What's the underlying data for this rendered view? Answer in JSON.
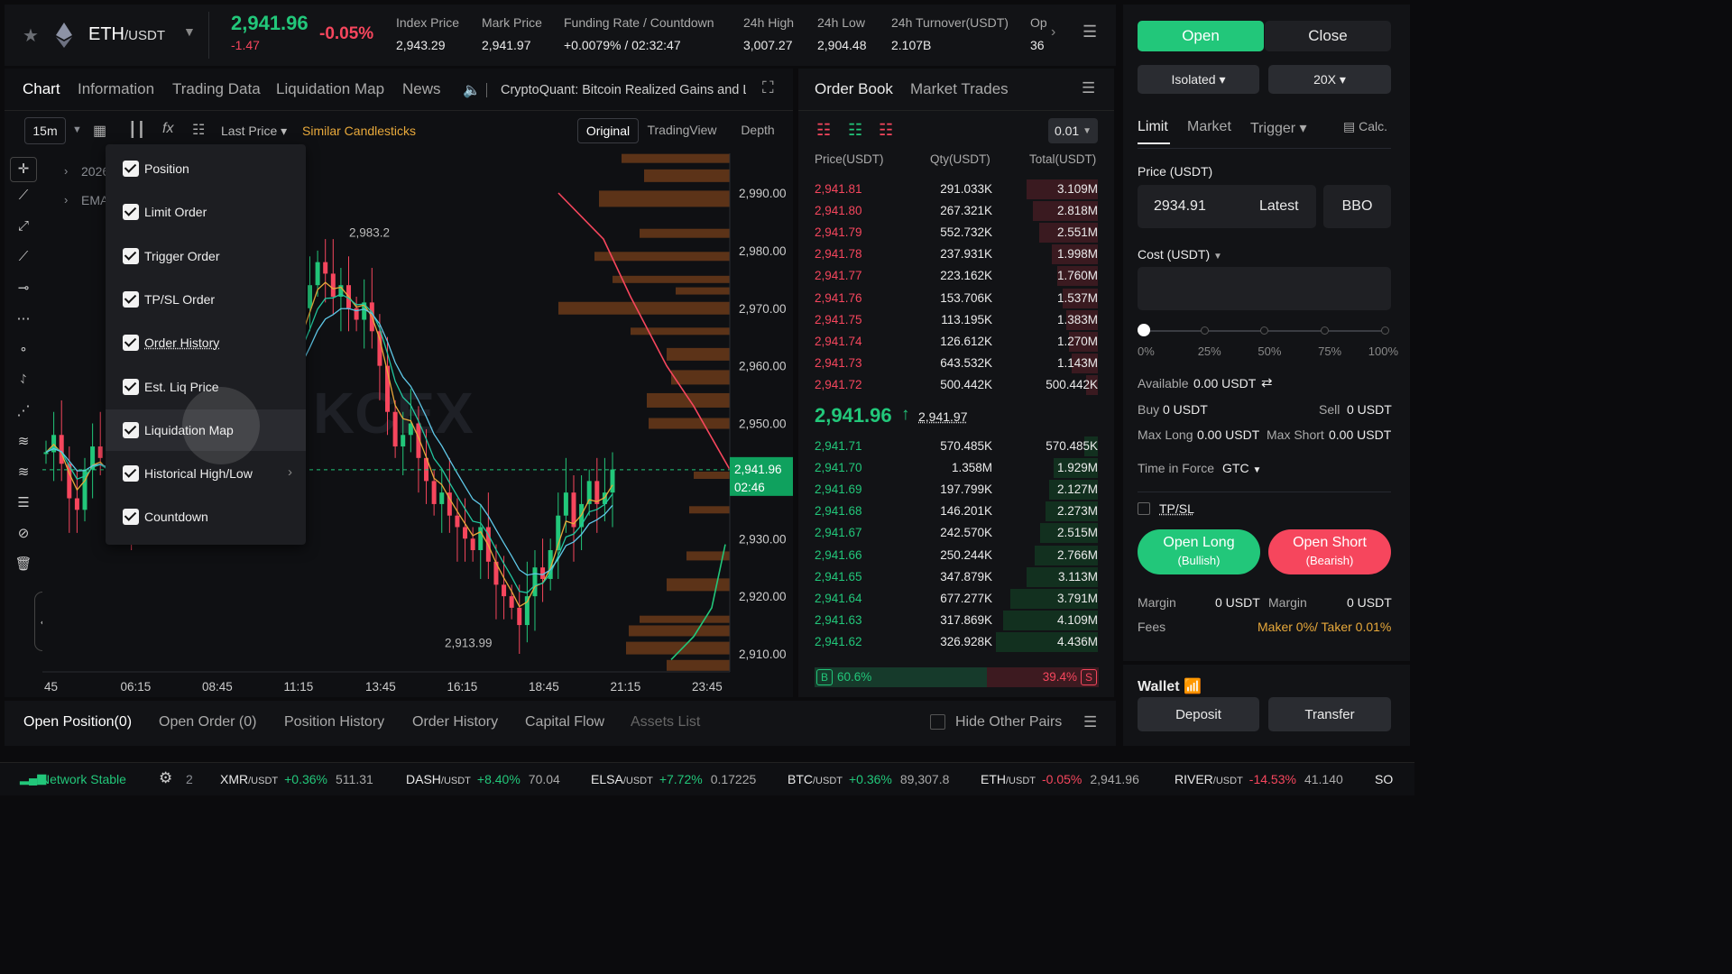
{
  "header": {
    "pair": "ETH",
    "quote": "/USDT",
    "last": "2,941.96",
    "change_abs": "-1.47",
    "change_pct": "-0.05%",
    "stats": [
      {
        "label": "Index Price",
        "value": "2,943.29"
      },
      {
        "label": "Mark Price",
        "value": "2,941.97"
      },
      {
        "label": "Funding Rate / Countdown",
        "value": "+0.0079% / 02:32:47"
      },
      {
        "label": "24h High",
        "value": "3,007.27"
      },
      {
        "label": "24h Low",
        "value": "2,904.48"
      },
      {
        "label": "24h Turnover(USDT)",
        "value": "2.107B"
      },
      {
        "label": "Op",
        "value": "36"
      }
    ]
  },
  "tabs": [
    "Chart",
    "Information",
    "Trading Data",
    "Liquidation Map",
    "News"
  ],
  "news_ticker": "CryptoQuant: Bitcoin Realized Gains and Lo",
  "toolbar": {
    "interval": "15m",
    "price_type": "Last Price",
    "similar": "Similar Candlesticks",
    "views": [
      "Original",
      "TradingView",
      "Depth"
    ]
  },
  "indicators": [
    "2026",
    "EMA"
  ],
  "menu": [
    "Position",
    "Limit Order",
    "Trigger Order",
    "TP/SL Order",
    "Order History",
    "Est. Liq Price",
    "Liquidation Map",
    "Historical High/Low",
    "Countdown"
  ],
  "chart": {
    "y_ticks": [
      "2,990.00",
      "2,980.00",
      "2,970.00",
      "2,960.00",
      "2,950.00",
      "2,930.00",
      "2,920.00",
      "2,910.00"
    ],
    "x_ticks": [
      "45",
      "06:15",
      "08:45",
      "11:15",
      "13:45",
      "16:15",
      "18:45",
      "21:15",
      "23:45"
    ],
    "high_label": "2,983.2",
    "low_label": "2,913.99",
    "price_tag": "2,941.96",
    "countdown_tag": "02:46",
    "watermark": "KCEX"
  },
  "orderbook": {
    "tabs": [
      "Order Book",
      "Market Trades"
    ],
    "precision": "0.01",
    "headers": [
      "Price(USDT)",
      "Qty(USDT)",
      "Total(USDT)"
    ],
    "asks": [
      [
        "2,941.81",
        "291.033K",
        "3.109M"
      ],
      [
        "2,941.80",
        "267.321K",
        "2.818M"
      ],
      [
        "2,941.79",
        "552.732K",
        "2.551M"
      ],
      [
        "2,941.78",
        "237.931K",
        "1.998M"
      ],
      [
        "2,941.77",
        "223.162K",
        "1.760M"
      ],
      [
        "2,941.76",
        "153.706K",
        "1.537M"
      ],
      [
        "2,941.75",
        "113.195K",
        "1.383M"
      ],
      [
        "2,941.74",
        "126.612K",
        "1.270M"
      ],
      [
        "2,941.73",
        "643.532K",
        "1.143M"
      ],
      [
        "2,941.72",
        "500.442K",
        "500.442K"
      ]
    ],
    "mid": "2,941.96",
    "mid_arrow": "↑",
    "mark": "2,941.97",
    "bids": [
      [
        "2,941.71",
        "570.485K",
        "570.485K"
      ],
      [
        "2,941.70",
        "1.358M",
        "1.929M"
      ],
      [
        "2,941.69",
        "197.799K",
        "2.127M"
      ],
      [
        "2,941.68",
        "146.201K",
        "2.273M"
      ],
      [
        "2,941.67",
        "242.570K",
        "2.515M"
      ],
      [
        "2,941.66",
        "250.244K",
        "2.766M"
      ],
      [
        "2,941.65",
        "347.879K",
        "3.113M"
      ],
      [
        "2,941.64",
        "677.277K",
        "3.791M"
      ],
      [
        "2,941.63",
        "317.869K",
        "4.109M"
      ],
      [
        "2,941.62",
        "326.928K",
        "4.436M"
      ]
    ],
    "buy_pct": "60.6%",
    "sell_pct": "39.4%",
    "b": "B",
    "s": "S"
  },
  "trade": {
    "open": "Open",
    "close": "Close",
    "margin_mode": "Isolated",
    "leverage": "20X",
    "types": [
      "Limit",
      "Market",
      "Trigger"
    ],
    "calc": "Calc.",
    "price_label": "Price (USDT)",
    "price_value": "2934.91",
    "latest": "Latest",
    "bbo": "BBO",
    "cost_label": "Cost (USDT)",
    "slider": [
      "0%",
      "25%",
      "50%",
      "75%",
      "100%"
    ],
    "available_label": "Available",
    "available": "0.00 USDT",
    "buy_label": "Buy",
    "buy": "0 USDT",
    "sell_label": "Sell",
    "sell": "0 USDT",
    "max_long_label": "Max Long",
    "max_long": "0.00 USDT",
    "max_short_label": "Max Short",
    "max_short": "0.00 USDT",
    "tif_label": "Time in Force",
    "tif": "GTC",
    "tpsl": "TP/SL",
    "long": "Open Long",
    "long_sub": "(Bullish)",
    "short": "Open Short",
    "short_sub": "(Bearish)",
    "margin_label": "Margin",
    "margin": "0 USDT",
    "margin2": "0 USDT",
    "fees_label": "Fees",
    "fees": "Maker 0%/ Taker 0.01%"
  },
  "wallet": {
    "title": "Wallet",
    "deposit": "Deposit",
    "transfer": "Transfer"
  },
  "bottom_tabs": [
    "Open Position(0)",
    "Open Order (0)",
    "Position History",
    "Order History",
    "Capital Flow",
    "Assets List"
  ],
  "hide_pairs": "Hide Other Pairs",
  "status": {
    "network": "Network Stable",
    "count": "2",
    "tickers": [
      {
        "s": "XMR",
        "q": "/USDT",
        "c": "+0.36%",
        "p": "511.31",
        "up": true
      },
      {
        "s": "DASH",
        "q": "/USDT",
        "c": "+8.40%",
        "p": "70.04",
        "up": true
      },
      {
        "s": "ELSA",
        "q": "/USDT",
        "c": "+7.72%",
        "p": "0.17225",
        "up": true
      },
      {
        "s": "BTC",
        "q": "/USDT",
        "c": "+0.36%",
        "p": "89,307.8",
        "up": true
      },
      {
        "s": "ETH",
        "q": "/USDT",
        "c": "-0.05%",
        "p": "2,941.96",
        "up": false
      },
      {
        "s": "RIVER",
        "q": "/USDT",
        "c": "-14.53%",
        "p": "41.140",
        "up": false
      },
      {
        "s": "SO",
        "q": "",
        "c": "",
        "p": "",
        "up": true
      }
    ]
  },
  "colors": {
    "green": "#22c77a",
    "red": "#f6465d",
    "accent": "#e8a93b"
  }
}
